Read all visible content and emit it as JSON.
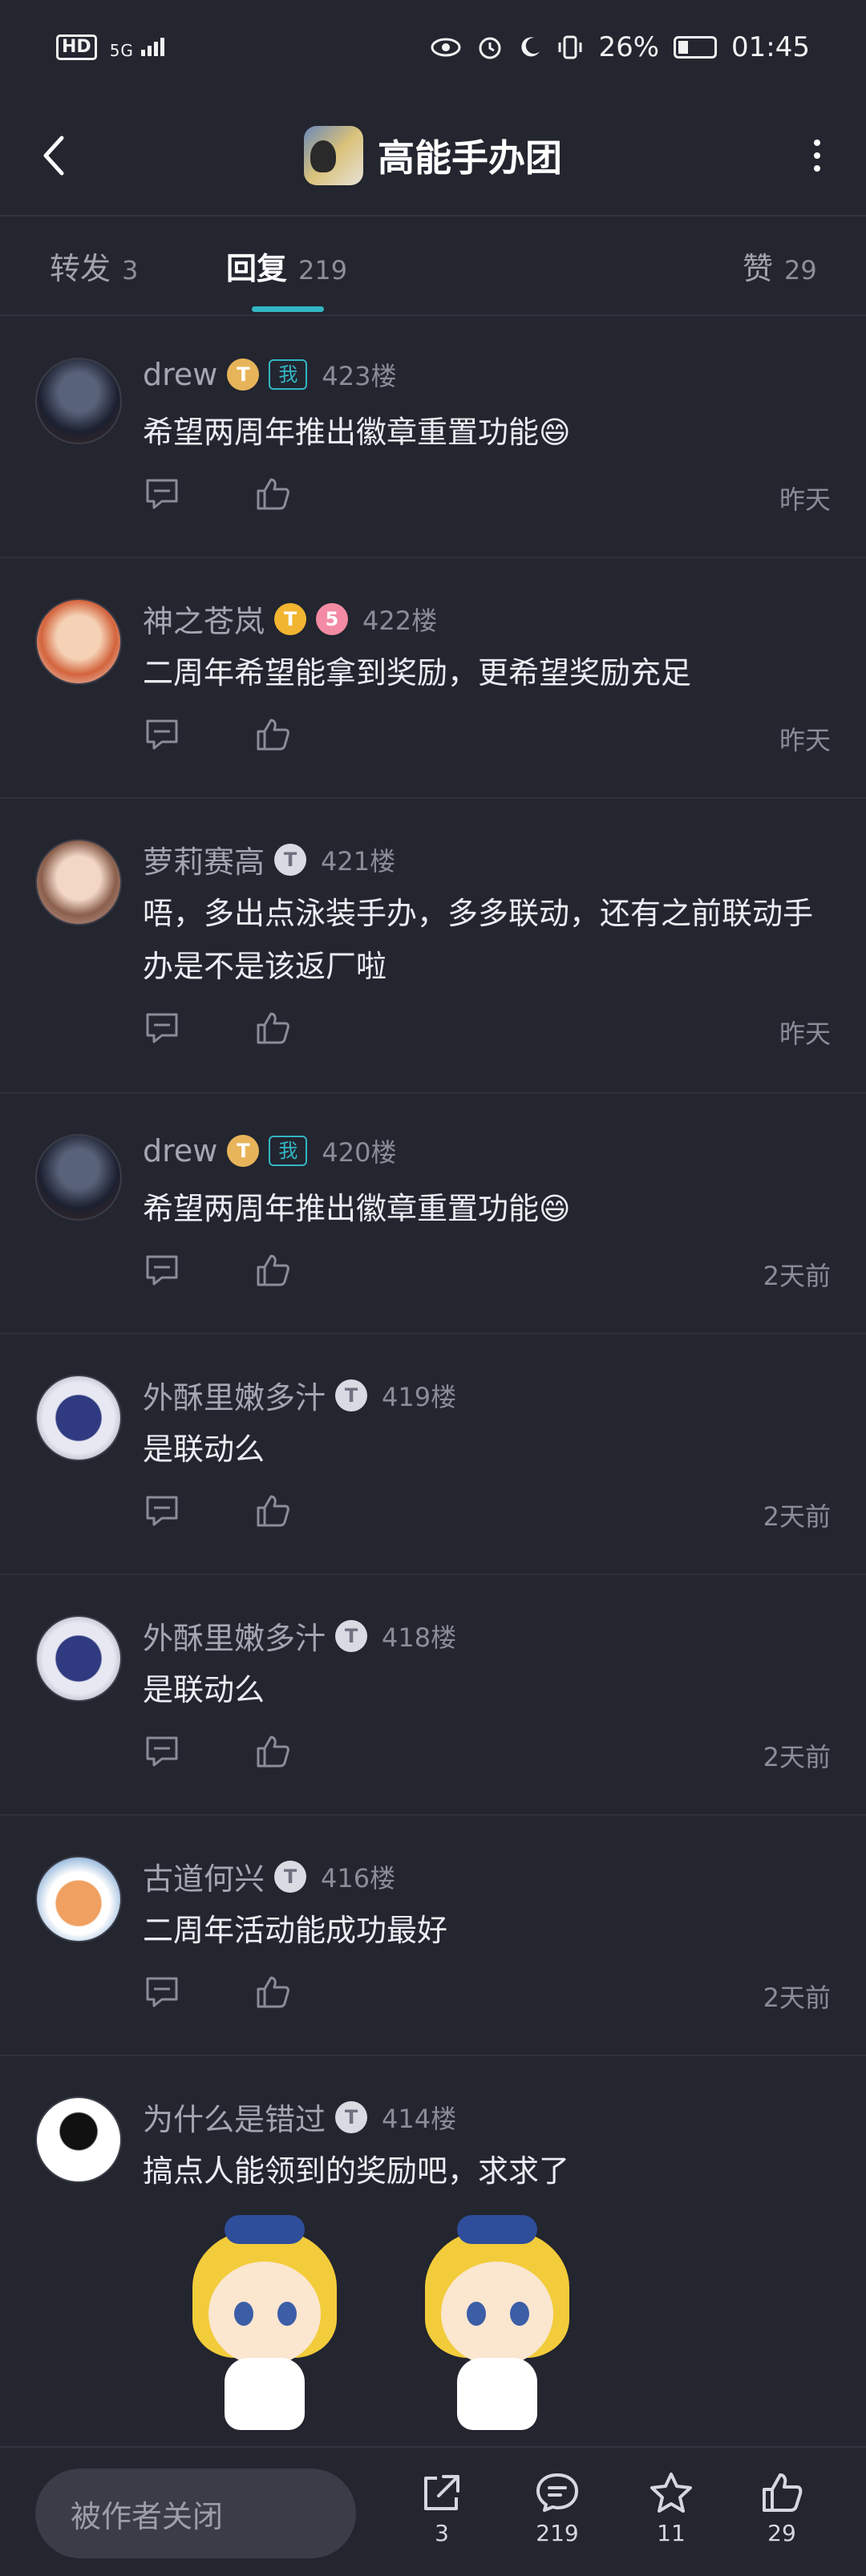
{
  "status": {
    "left_labels": [
      "HD",
      "5G"
    ],
    "battery": "26%",
    "time": "01:45"
  },
  "header": {
    "title": "高能手办团"
  },
  "tabs": [
    {
      "label": "转发",
      "count": "3"
    },
    {
      "label": "回复",
      "count": "219"
    },
    {
      "label": "赞",
      "count": "29"
    }
  ],
  "posts": [
    {
      "user": "drew",
      "level": "T",
      "me": "我",
      "floor": "423楼",
      "content": "希望两周年推出徽章重置功能😄",
      "time": "昨天"
    },
    {
      "user": "神之苍岚",
      "level": "T",
      "extra": "5",
      "floor": "422楼",
      "content": "二周年希望能拿到奖励，更希望奖励充足",
      "time": "昨天"
    },
    {
      "user": "萝莉赛高",
      "level": "T",
      "floor": "421楼",
      "content": "唔，多出点泳装手办，多多联动，还有之前联动手办是不是该返厂啦",
      "time": "昨天"
    },
    {
      "user": "drew",
      "level": "T",
      "me": "我",
      "floor": "420楼",
      "content": "希望两周年推出徽章重置功能😄",
      "time": "2天前"
    },
    {
      "user": "外酥里嫩多汁",
      "level": "T",
      "floor": "419楼",
      "content": "是联动么",
      "time": "2天前"
    },
    {
      "user": "外酥里嫩多汁",
      "level": "T",
      "floor": "418楼",
      "content": "是联动么",
      "time": "2天前"
    },
    {
      "user": "古道何兴",
      "level": "T",
      "floor": "416楼",
      "content": "二周年活动能成功最好",
      "time": "2天前"
    },
    {
      "user": "为什么是错过",
      "level": "T",
      "floor": "414楼",
      "content": "搞点人能领到的奖励吧，求求了"
    }
  ],
  "bottom": {
    "input_placeholder": "被作者关闭",
    "share_count": "3",
    "comment_count": "219",
    "star_count": "11",
    "like_count": "29"
  },
  "colors": {
    "background": "#23252f",
    "accent": "#33b6c4"
  }
}
